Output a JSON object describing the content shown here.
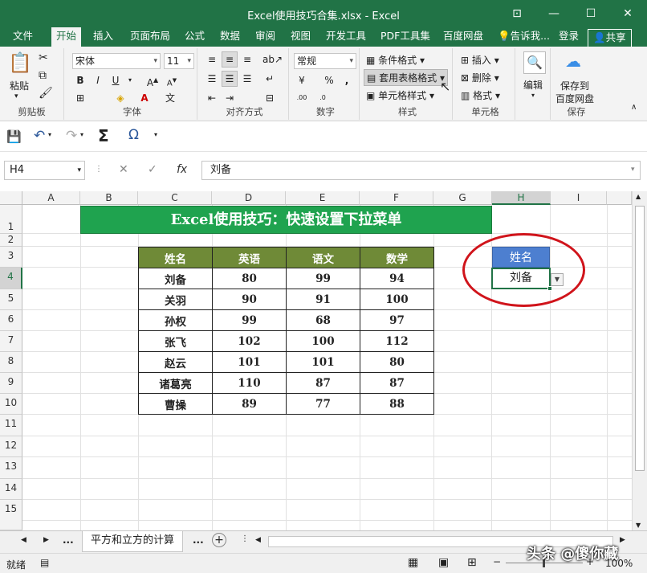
{
  "window": {
    "title": "Excel使用技巧合集.xlsx - Excel"
  },
  "tabs": {
    "file": "文件",
    "home": "开始",
    "insert": "插入",
    "page_layout": "页面布局",
    "formulas": "公式",
    "data": "数据",
    "review": "审阅",
    "view": "视图",
    "developer": "开发工具",
    "pdf": "PDF工具集",
    "baidu": "百度网盘",
    "tell_me": "告诉我...",
    "login": "登录",
    "share": "共享"
  },
  "ribbon": {
    "clipboard": {
      "label": "剪贴板",
      "paste": "粘贴"
    },
    "font": {
      "label": "字体",
      "name": "宋体",
      "size": "11"
    },
    "alignment": {
      "label": "对齐方式"
    },
    "number": {
      "label": "数字",
      "format": "常规"
    },
    "styles": {
      "label": "样式",
      "conditional": "条件格式",
      "table_format": "套用表格格式",
      "cell_styles": "单元格样式"
    },
    "cells": {
      "label": "单元格",
      "insert": "插入",
      "delete": "删除",
      "format": "格式"
    },
    "editing": {
      "label": "编辑"
    },
    "save": {
      "line1": "保存到",
      "line2": "百度网盘",
      "label": "保存"
    }
  },
  "formula_bar": {
    "cell_ref": "H4",
    "content": "刘备"
  },
  "columns": [
    "A",
    "B",
    "C",
    "D",
    "E",
    "F",
    "G",
    "H",
    "I"
  ],
  "rows": [
    "1",
    "2",
    "3",
    "4",
    "5",
    "6",
    "7",
    "8",
    "9",
    "10",
    "11",
    "12",
    "13",
    "14",
    "15"
  ],
  "sheet": {
    "banner": "Excel使用技巧：快速设置下拉菜单",
    "table_headers": [
      "姓名",
      "英语",
      "语文",
      "数学"
    ],
    "table_rows": [
      [
        "刘备",
        "80",
        "99",
        "94"
      ],
      [
        "关羽",
        "90",
        "91",
        "100"
      ],
      [
        "孙权",
        "99",
        "68",
        "97"
      ],
      [
        "张飞",
        "102",
        "100",
        "112"
      ],
      [
        "赵云",
        "101",
        "101",
        "80"
      ],
      [
        "诸葛亮",
        "110",
        "87",
        "87"
      ],
      [
        "曹操",
        "89",
        "77",
        "88"
      ]
    ],
    "lookup_header": "姓名",
    "lookup_value": "刘备"
  },
  "sheet_tabs": {
    "active": "平方和立方的计算",
    "more": "..."
  },
  "status": {
    "ready": "就绪",
    "zoom": "100%"
  },
  "watermark": "头条 @傻你藏"
}
